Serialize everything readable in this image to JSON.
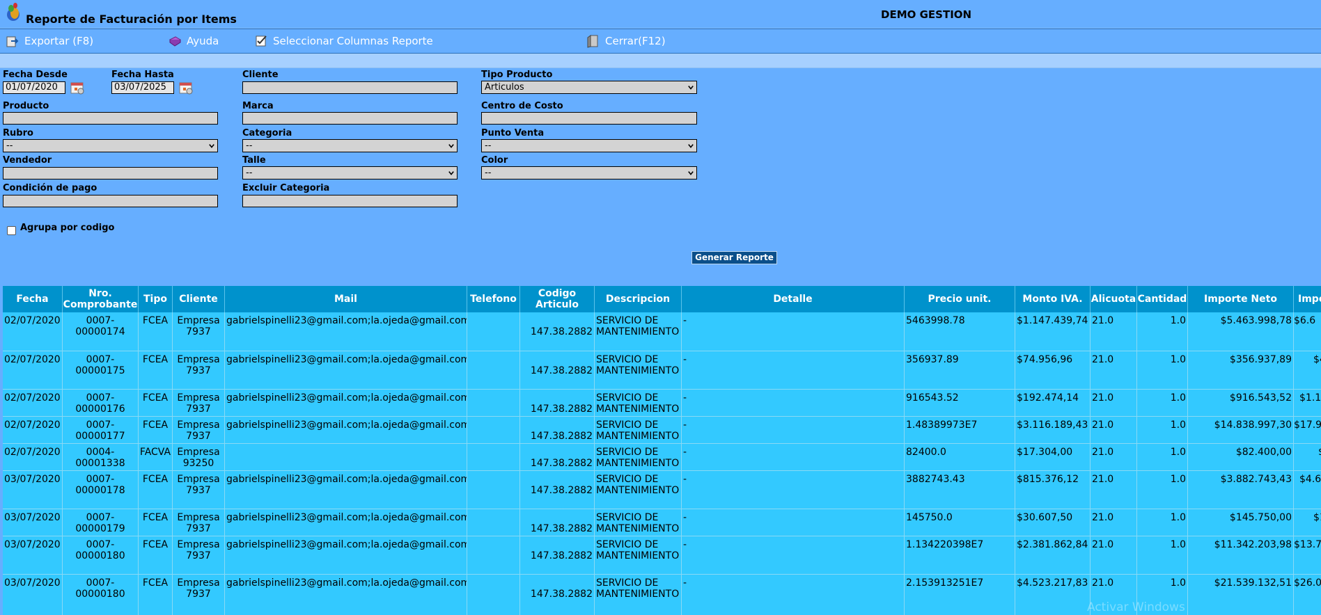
{
  "titlebar": {
    "title": "Reporte de Facturación por Items",
    "company": "DEMO GESTION"
  },
  "toolbar": {
    "export": "Exportar (F8)",
    "help": "Ayuda",
    "columns": "Seleccionar Columnas Reporte",
    "close": "Cerrar(F12)"
  },
  "form": {
    "fecha_desde_label": "Fecha Desde",
    "fecha_desde_value": "01/07/2020",
    "fecha_hasta_label": "Fecha Hasta",
    "fecha_hasta_value": "03/07/2025",
    "cliente_label": "Cliente",
    "tipo_producto_label": "Tipo Producto",
    "tipo_producto_value": "Articulos",
    "producto_label": "Producto",
    "marca_label": "Marca",
    "centro_costo_label": "Centro de Costo",
    "rubro_label": "Rubro",
    "rubro_value": "--",
    "categoria_label": "Categoria",
    "categoria_value": "--",
    "punto_venta_label": "Punto Venta",
    "punto_venta_value": "--",
    "vendedor_label": "Vendedor",
    "talle_label": "Talle",
    "talle_value": "--",
    "color_label": "Color",
    "color_value": "--",
    "condicion_pago_label": "Condición de pago",
    "excluir_categoria_label": "Excluir Categoria",
    "agrupa_label": "Agrupa por codigo",
    "generar_label": "Generar Reporte"
  },
  "table": {
    "headers": {
      "fecha": "Fecha",
      "nro_l1": "Nro.",
      "nro_l2": "Comprobante",
      "tipo": "Tipo",
      "cliente": "Cliente",
      "mail": "Mail",
      "telefono": "Telefono",
      "codigo_l1": "Codigo",
      "codigo_l2": "Articulo",
      "descripcion": "Descripcion",
      "detalle": "Detalle",
      "precio": "Precio unit.",
      "monto_iva": "Monto IVA.",
      "alicuota": "Alicuota",
      "cantidad": "Cantidad",
      "importe_neto": "Importe Neto",
      "importe_total": "Impo"
    },
    "rows": [
      {
        "fecha": "02/07/2020",
        "nro1": "0007-",
        "nro2": "00000174",
        "tipo": "FCEA",
        "cli1": "Empresa",
        "cli2": "7937",
        "mail": "gabrielspinelli23@gmail.com;la.ojeda@gmail.com",
        "tel": "",
        "codigo": "147.38.2882",
        "desc1": "SERVICIO DE",
        "desc2": "MANTENIMIENTO",
        "detalle": "-",
        "precio": "5463998.78",
        "iva": "$1.147.439,74",
        "alic": "21.0",
        "cant": "1.0",
        "neto": "$5.463.998,78",
        "total": "$6.6"
      },
      {
        "fecha": "02/07/2020",
        "nro1": "0007-",
        "nro2": "00000175",
        "tipo": "FCEA",
        "cli1": "Empresa",
        "cli2": "7937",
        "mail": "gabrielspinelli23@gmail.com;la.ojeda@gmail.com",
        "tel": "",
        "codigo": "147.38.2882",
        "desc1": "SERVICIO DE",
        "desc2": "MANTENIMIENTO",
        "detalle": "-",
        "precio": "356937.89",
        "iva": "$74.956,96",
        "alic": "21.0",
        "cant": "1.0",
        "neto": "$356.937,89",
        "total": "$4"
      },
      {
        "fecha": "02/07/2020",
        "nro1": "0007-",
        "nro2": "00000176",
        "tipo": "FCEA",
        "cli1": "Empresa",
        "cli2": "7937",
        "mail": "gabrielspinelli23@gmail.com;la.ojeda@gmail.com",
        "tel": "",
        "codigo": "147.38.2882",
        "desc1": "SERVICIO DE",
        "desc2": "MANTENIMIENTO",
        "detalle": "-",
        "precio": "916543.52",
        "iva": "$192.474,14",
        "alic": "21.0",
        "cant": "1.0",
        "neto": "$916.543,52",
        "total": "$1.1"
      },
      {
        "fecha": "02/07/2020",
        "nro1": "0007-",
        "nro2": "00000177",
        "tipo": "FCEA",
        "cli1": "Empresa",
        "cli2": "7937",
        "mail": "gabrielspinelli23@gmail.com;la.ojeda@gmail.com",
        "tel": "",
        "codigo": "147.38.2882",
        "desc1": "SERVICIO DE",
        "desc2": "MANTENIMIENTO",
        "detalle": "-",
        "precio": "1.48389973E7",
        "iva": "$3.116.189,43",
        "alic": "21.0",
        "cant": "1.0",
        "neto": "$14.838.997,30",
        "total": "$17.9"
      },
      {
        "fecha": "02/07/2020",
        "nro1": "0004-",
        "nro2": "00001338",
        "tipo": "FACVA",
        "cli1": "Empresa",
        "cli2": "93250",
        "mail": "",
        "tel": "",
        "codigo": "147.38.2882",
        "desc1": "SERVICIO DE",
        "desc2": "MANTENIMIENTO",
        "detalle": "-",
        "precio": "82400.0",
        "iva": "$17.304,00",
        "alic": "21.0",
        "cant": "1.0",
        "neto": "$82.400,00",
        "total": "$"
      },
      {
        "fecha": "03/07/2020",
        "nro1": "0007-",
        "nro2": "00000178",
        "tipo": "FCEA",
        "cli1": "Empresa",
        "cli2": "7937",
        "mail": "gabrielspinelli23@gmail.com;la.ojeda@gmail.com",
        "tel": "",
        "codigo": "147.38.2882",
        "desc1": "SERVICIO DE",
        "desc2": "MANTENIMIENTO",
        "detalle": "-",
        "precio": "3882743.43",
        "iva": "$815.376,12",
        "alic": "21.0",
        "cant": "1.0",
        "neto": "$3.882.743,43",
        "total": "$4.6"
      },
      {
        "fecha": "03/07/2020",
        "nro1": "0007-",
        "nro2": "00000179",
        "tipo": "FCEA",
        "cli1": "Empresa",
        "cli2": "7937",
        "mail": "gabrielspinelli23@gmail.com;la.ojeda@gmail.com",
        "tel": "",
        "codigo": "147.38.2882",
        "desc1": "SERVICIO DE",
        "desc2": "MANTENIMIENTO",
        "detalle": "-",
        "precio": "145750.0",
        "iva": "$30.607,50",
        "alic": "21.0",
        "cant": "1.0",
        "neto": "$145.750,00",
        "total": "$1"
      },
      {
        "fecha": "03/07/2020",
        "nro1": "0007-",
        "nro2": "00000180",
        "tipo": "FCEA",
        "cli1": "Empresa",
        "cli2": "7937",
        "mail": "gabrielspinelli23@gmail.com;la.ojeda@gmail.com",
        "tel": "",
        "codigo": "147.38.2882",
        "desc1": "SERVICIO DE",
        "desc2": "MANTENIMIENTO",
        "detalle": "-",
        "precio": "1.134220398E7",
        "iva": "$2.381.862,84",
        "alic": "21.0",
        "cant": "1.0",
        "neto": "$11.342.203,98",
        "total": "$13.7"
      },
      {
        "fecha": "03/07/2020",
        "nro1": "0007-",
        "nro2": "00000180",
        "tipo": "FCEA",
        "cli1": "Empresa",
        "cli2": "7937",
        "mail": "gabrielspinelli23@gmail.com;la.ojeda@gmail.com",
        "tel": "",
        "codigo": "147.38.2882",
        "desc1": "SERVICIO DE",
        "desc2": "MANTENIMIENTO",
        "detalle": "-",
        "precio": "2.153913251E7",
        "iva": "$4.523.217,83",
        "alic": "21.0",
        "cant": "1.0",
        "neto": "$21.539.132,51",
        "total": "$26.0"
      }
    ]
  },
  "watermark": "Activar Windows"
}
